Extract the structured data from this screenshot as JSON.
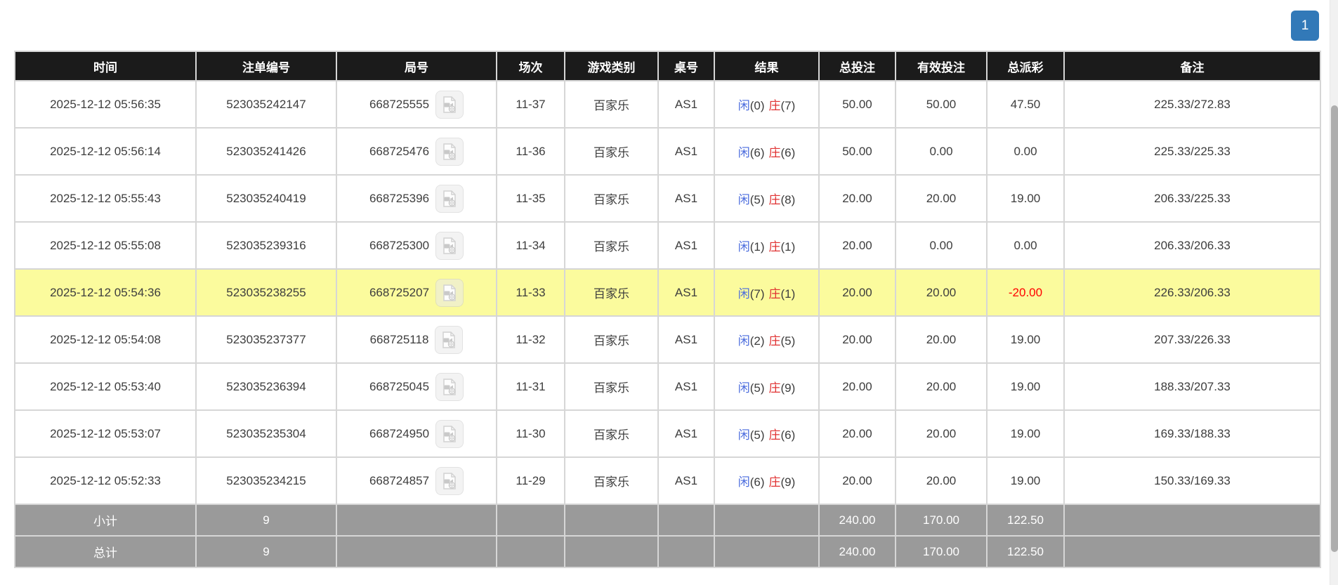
{
  "pagination": {
    "page": "1"
  },
  "colors": {
    "accent": "#3279b8",
    "header_bg": "#1b1b1b",
    "footer_bg": "#9a9a9a",
    "highlight": "#fbfb9d",
    "player_blue": "#4a6bdd",
    "banker_red": "#e03131",
    "amount_blue": "#2b6bde",
    "negative_red": "#ff0000"
  },
  "icons": {
    "video_replay": "video-replay-icon"
  },
  "table": {
    "columns": [
      "时间",
      "注单编号",
      "局号",
      "场次",
      "游戏类别",
      "桌号",
      "结果",
      "总投注",
      "有效投注",
      "总派彩",
      "备注"
    ],
    "rows": [
      {
        "time": "2025-12-12 05:56:35",
        "bet_id": "523035242147",
        "round_id": "668725555",
        "session": "11-37",
        "game_type": "百家乐",
        "table_id": "AS1",
        "result_player": "闲",
        "result_player_score": "(0)",
        "result_banker": "庄",
        "result_banker_score": "(7)",
        "total_bet": "50.00",
        "valid_bet": "50.00",
        "payout": "47.50",
        "remark": "225.33/272.83",
        "highlighted": false,
        "payout_negative": false
      },
      {
        "time": "2025-12-12 05:56:14",
        "bet_id": "523035241426",
        "round_id": "668725476",
        "session": "11-36",
        "game_type": "百家乐",
        "table_id": "AS1",
        "result_player": "闲",
        "result_player_score": "(6)",
        "result_banker": "庄",
        "result_banker_score": "(6)",
        "total_bet": "50.00",
        "valid_bet": "0.00",
        "payout": "0.00",
        "remark": "225.33/225.33",
        "highlighted": false,
        "payout_negative": false
      },
      {
        "time": "2025-12-12 05:55:43",
        "bet_id": "523035240419",
        "round_id": "668725396",
        "session": "11-35",
        "game_type": "百家乐",
        "table_id": "AS1",
        "result_player": "闲",
        "result_player_score": "(5)",
        "result_banker": "庄",
        "result_banker_score": "(8)",
        "total_bet": "20.00",
        "valid_bet": "20.00",
        "payout": "19.00",
        "remark": "206.33/225.33",
        "highlighted": false,
        "payout_negative": false
      },
      {
        "time": "2025-12-12 05:55:08",
        "bet_id": "523035239316",
        "round_id": "668725300",
        "session": "11-34",
        "game_type": "百家乐",
        "table_id": "AS1",
        "result_player": "闲",
        "result_player_score": "(1)",
        "result_banker": "庄",
        "result_banker_score": "(1)",
        "total_bet": "20.00",
        "valid_bet": "0.00",
        "payout": "0.00",
        "remark": "206.33/206.33",
        "highlighted": false,
        "payout_negative": false
      },
      {
        "time": "2025-12-12 05:54:36",
        "bet_id": "523035238255",
        "round_id": "668725207",
        "session": "11-33",
        "game_type": "百家乐",
        "table_id": "AS1",
        "result_player": "闲",
        "result_player_score": "(7)",
        "result_banker": "庄",
        "result_banker_score": "(1)",
        "total_bet": "20.00",
        "valid_bet": "20.00",
        "payout": "-20.00",
        "remark": "226.33/206.33",
        "highlighted": true,
        "payout_negative": true
      },
      {
        "time": "2025-12-12 05:54:08",
        "bet_id": "523035237377",
        "round_id": "668725118",
        "session": "11-32",
        "game_type": "百家乐",
        "table_id": "AS1",
        "result_player": "闲",
        "result_player_score": "(2)",
        "result_banker": "庄",
        "result_banker_score": "(5)",
        "total_bet": "20.00",
        "valid_bet": "20.00",
        "payout": "19.00",
        "remark": "207.33/226.33",
        "highlighted": false,
        "payout_negative": false
      },
      {
        "time": "2025-12-12 05:53:40",
        "bet_id": "523035236394",
        "round_id": "668725045",
        "session": "11-31",
        "game_type": "百家乐",
        "table_id": "AS1",
        "result_player": "闲",
        "result_player_score": "(5)",
        "result_banker": "庄",
        "result_banker_score": "(9)",
        "total_bet": "20.00",
        "valid_bet": "20.00",
        "payout": "19.00",
        "remark": "188.33/207.33",
        "highlighted": false,
        "payout_negative": false
      },
      {
        "time": "2025-12-12 05:53:07",
        "bet_id": "523035235304",
        "round_id": "668724950",
        "session": "11-30",
        "game_type": "百家乐",
        "table_id": "AS1",
        "result_player": "闲",
        "result_player_score": "(5)",
        "result_banker": "庄",
        "result_banker_score": "(6)",
        "total_bet": "20.00",
        "valid_bet": "20.00",
        "payout": "19.00",
        "remark": "169.33/188.33",
        "highlighted": false,
        "payout_negative": false
      },
      {
        "time": "2025-12-12 05:52:33",
        "bet_id": "523035234215",
        "round_id": "668724857",
        "session": "11-29",
        "game_type": "百家乐",
        "table_id": "AS1",
        "result_player": "闲",
        "result_player_score": "(6)",
        "result_banker": "庄",
        "result_banker_score": "(9)",
        "total_bet": "20.00",
        "valid_bet": "20.00",
        "payout": "19.00",
        "remark": "150.33/169.33",
        "highlighted": false,
        "payout_negative": false
      }
    ],
    "footer": [
      {
        "label": "小计",
        "count": "9",
        "total_bet": "240.00",
        "valid_bet": "170.00",
        "payout": "122.50",
        "remark": ""
      },
      {
        "label": "总计",
        "count": "9",
        "total_bet": "240.00",
        "valid_bet": "170.00",
        "payout": "122.50",
        "remark": ""
      }
    ]
  }
}
